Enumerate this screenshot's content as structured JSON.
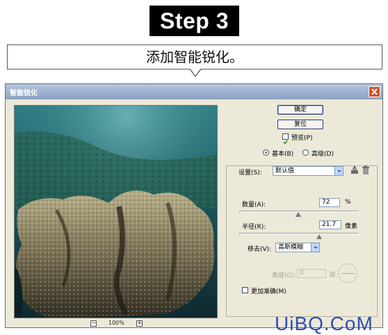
{
  "header": {
    "step_badge": "Step 3",
    "callout_text": "添加智能锐化。"
  },
  "dialog": {
    "title": "智能锐化",
    "buttons": {
      "ok": "确定",
      "reset": "复位"
    },
    "preview_checkbox": {
      "label": "预览(P)",
      "checked": true
    },
    "mode": {
      "basic_label": "基本(B)",
      "advanced_label": "高级(D)",
      "selected": "basic"
    },
    "settings": {
      "label": "设置(S):",
      "value": "默认值"
    },
    "amount": {
      "label": "数量(A):",
      "value": "72",
      "unit": "%",
      "slider_fraction": 0.49
    },
    "radius": {
      "label": "半径(R):",
      "value": "21.7",
      "unit": "像素",
      "slider_fraction": 0.66
    },
    "remove": {
      "label": "移去(V):",
      "value": "高斯模糊"
    },
    "angle": {
      "label": "角度(G):",
      "value": "0",
      "unit": "度",
      "enabled": false
    },
    "more_accurate": {
      "label": "更加准确(M)",
      "checked": false
    },
    "zoom": {
      "minus": "−",
      "value": "100%",
      "plus": "+"
    }
  },
  "watermark": "UiBQ.CoM",
  "colors": {
    "dialog_bg": "#ece9d8",
    "title_gradient_top": "#b6c6dc",
    "close_button": "#d4502f",
    "watermark": "#2f4fb0"
  }
}
